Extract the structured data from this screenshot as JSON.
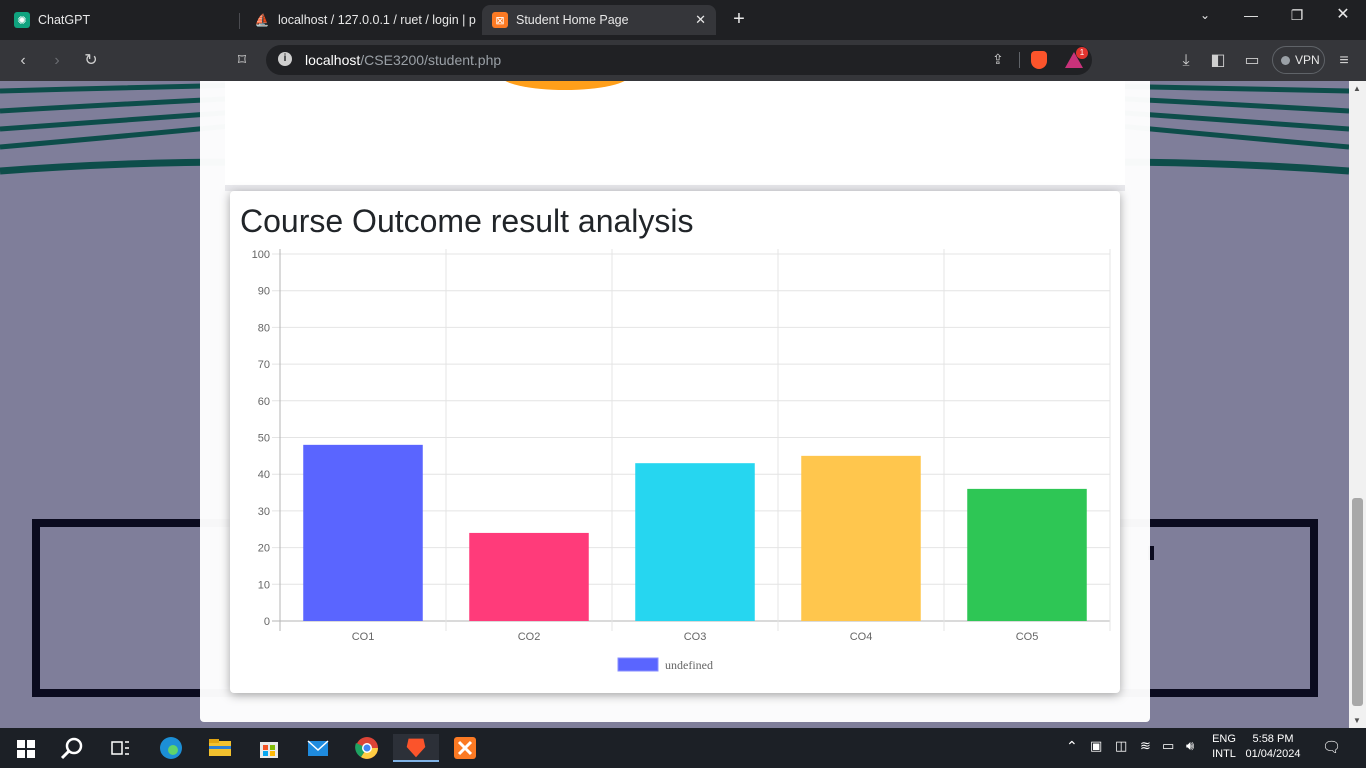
{
  "browser": {
    "tabs": [
      {
        "label": "ChatGPT"
      },
      {
        "label": "localhost / 127.0.0.1 / ruet / login | p"
      },
      {
        "label": "Student Home Page"
      }
    ],
    "url_host": "localhost",
    "url_path": "/CSE3200/student.php",
    "vpn_label": "VPN",
    "rewards_badge": "1"
  },
  "page": {
    "chart_title": "Course Outcome result analysis"
  },
  "chart_data": {
    "type": "bar",
    "title": "",
    "categories": [
      "CO1",
      "CO2",
      "CO3",
      "CO4",
      "CO5"
    ],
    "values": [
      48,
      24,
      43,
      45,
      36
    ],
    "colors": [
      "#5a65ff",
      "#ff3b7a",
      "#26d6f0",
      "#ffc64d",
      "#2ec655"
    ],
    "ylim": [
      0,
      100
    ],
    "yticks": [
      0,
      10,
      20,
      30,
      40,
      50,
      60,
      70,
      80,
      90,
      100
    ],
    "grid": true,
    "legend": {
      "label": "undefined",
      "color": "#5a65ff",
      "position": "bottom"
    },
    "xlabel": "",
    "ylabel": ""
  },
  "taskbar": {
    "lang": "ENG",
    "layout": "INTL",
    "time": "5:58 PM",
    "date": "01/04/2024"
  }
}
